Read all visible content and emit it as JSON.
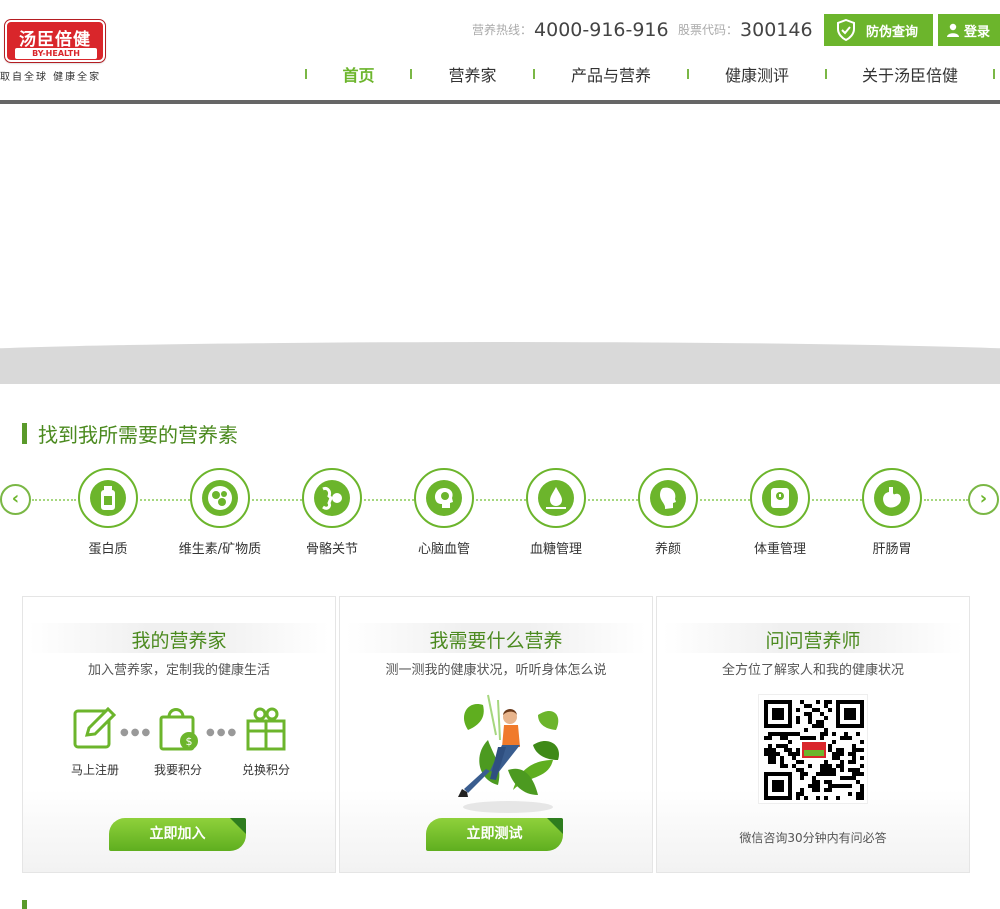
{
  "header": {
    "logo_cn": "汤臣倍健",
    "logo_en": "BY-HEALTH",
    "slogan": "取自全球 健康全家",
    "hotline_label": "营养热线：",
    "hotline_number": "4000-916-916",
    "stock_label": "股票代码：",
    "stock_number": "300146",
    "check_button": "防伪查询",
    "login_button": "登录"
  },
  "nav": {
    "items": [
      {
        "label": "首页",
        "active": true
      },
      {
        "label": "营养家",
        "active": false
      },
      {
        "label": "产品与营养",
        "active": false
      },
      {
        "label": "健康测评",
        "active": false
      },
      {
        "label": "关于汤臣倍健",
        "active": false
      }
    ]
  },
  "section": {
    "title": "找到我所需要的营养素"
  },
  "categories": [
    {
      "label": "蛋白质",
      "icon": "bottle-icon"
    },
    {
      "label": "维生素/矿物质",
      "icon": "pills-icon"
    },
    {
      "label": "骨骼关节",
      "icon": "joint-icon"
    },
    {
      "label": "心脑血管",
      "icon": "brain-icon"
    },
    {
      "label": "血糖管理",
      "icon": "drop-icon"
    },
    {
      "label": "养颜",
      "icon": "face-icon"
    },
    {
      "label": "体重管理",
      "icon": "scale-icon"
    },
    {
      "label": "肝肠胃",
      "icon": "stomach-icon"
    }
  ],
  "arrows": {
    "prev": "‹",
    "next": "›"
  },
  "cards": {
    "card1": {
      "title": "我的营养家",
      "subtitle": "加入营养家，定制我的健康生活",
      "steps": [
        "马上注册",
        "我要积分",
        "兑换积分"
      ],
      "button": "立即加入"
    },
    "card2": {
      "title": "我需要什么营养",
      "subtitle": "测一测我的健康状况，听听身体怎么说",
      "button": "立即测试"
    },
    "card3": {
      "title": "问问营养师",
      "subtitle": "全方位了解家人和我的健康状况",
      "note": "微信咨询30分钟内有问必答"
    }
  },
  "colors": {
    "brand_green": "#6cb52c",
    "title_green": "#4b8a1f",
    "logo_red": "#d9262b"
  }
}
